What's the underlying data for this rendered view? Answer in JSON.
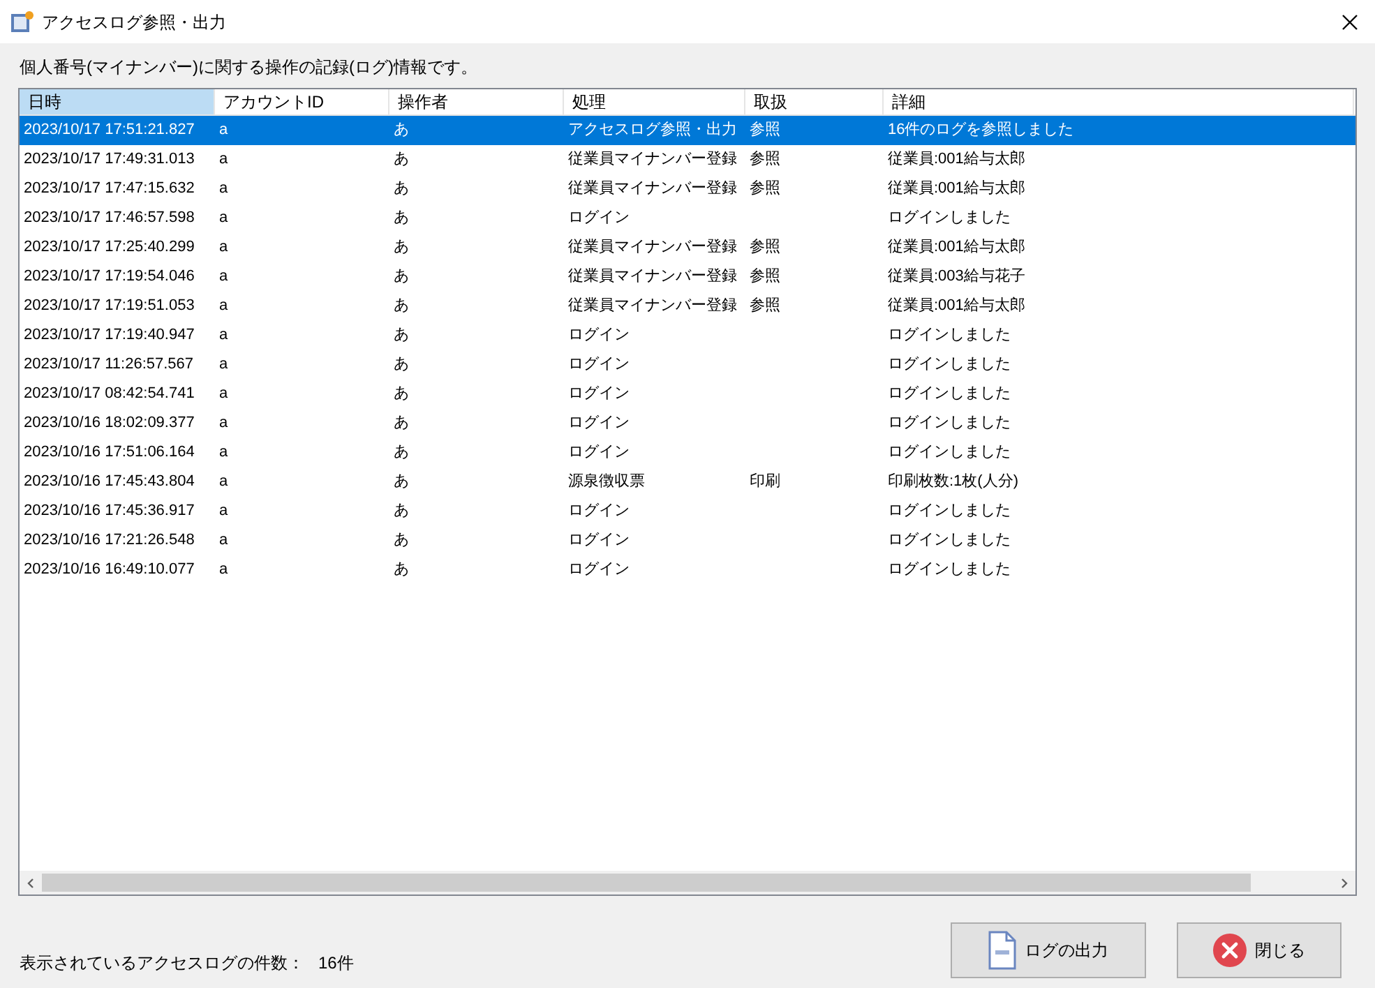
{
  "window": {
    "title": "アクセスログ参照・出力"
  },
  "description": "個人番号(マイナンバー)に関する操作の記録(ログ)情報です。",
  "table": {
    "columns": [
      {
        "label": "日時",
        "selected": true
      },
      {
        "label": "アカウントID",
        "selected": false
      },
      {
        "label": "操作者",
        "selected": false
      },
      {
        "label": "処理",
        "selected": false
      },
      {
        "label": "取扱",
        "selected": false
      },
      {
        "label": "詳細",
        "selected": false
      }
    ],
    "rows": [
      {
        "selected": true,
        "cells": [
          "2023/10/17 17:51:21.827",
          "a",
          "あ",
          "アクセスログ参照・出力",
          "参照",
          "16件のログを参照しました"
        ]
      },
      {
        "selected": false,
        "cells": [
          "2023/10/17 17:49:31.013",
          "a",
          "あ",
          "従業員マイナンバー登録",
          "参照",
          "従業員:001給与太郎"
        ]
      },
      {
        "selected": false,
        "cells": [
          "2023/10/17 17:47:15.632",
          "a",
          "あ",
          "従業員マイナンバー登録",
          "参照",
          "従業員:001給与太郎"
        ]
      },
      {
        "selected": false,
        "cells": [
          "2023/10/17 17:46:57.598",
          "a",
          "あ",
          "ログイン",
          "",
          "ログインしました"
        ]
      },
      {
        "selected": false,
        "cells": [
          "2023/10/17 17:25:40.299",
          "a",
          "あ",
          "従業員マイナンバー登録",
          "参照",
          "従業員:001給与太郎"
        ]
      },
      {
        "selected": false,
        "cells": [
          "2023/10/17 17:19:54.046",
          "a",
          "あ",
          "従業員マイナンバー登録",
          "参照",
          "従業員:003給与花子"
        ]
      },
      {
        "selected": false,
        "cells": [
          "2023/10/17 17:19:51.053",
          "a",
          "あ",
          "従業員マイナンバー登録",
          "参照",
          "従業員:001給与太郎"
        ]
      },
      {
        "selected": false,
        "cells": [
          "2023/10/17 17:19:40.947",
          "a",
          "あ",
          "ログイン",
          "",
          "ログインしました"
        ]
      },
      {
        "selected": false,
        "cells": [
          "2023/10/17 11:26:57.567",
          "a",
          "あ",
          "ログイン",
          "",
          "ログインしました"
        ]
      },
      {
        "selected": false,
        "cells": [
          "2023/10/17 08:42:54.741",
          "a",
          "あ",
          "ログイン",
          "",
          "ログインしました"
        ]
      },
      {
        "selected": false,
        "cells": [
          "2023/10/16 18:02:09.377",
          "a",
          "あ",
          "ログイン",
          "",
          "ログインしました"
        ]
      },
      {
        "selected": false,
        "cells": [
          "2023/10/16 17:51:06.164",
          "a",
          "あ",
          "ログイン",
          "",
          "ログインしました"
        ]
      },
      {
        "selected": false,
        "cells": [
          "2023/10/16 17:45:43.804",
          "a",
          "あ",
          "源泉徴収票",
          "印刷",
          "印刷枚数:1枚(人分)"
        ]
      },
      {
        "selected": false,
        "cells": [
          "2023/10/16 17:45:36.917",
          "a",
          "あ",
          "ログイン",
          "",
          "ログインしました"
        ]
      },
      {
        "selected": false,
        "cells": [
          "2023/10/16 17:21:26.548",
          "a",
          "あ",
          "ログイン",
          "",
          "ログインしました"
        ]
      },
      {
        "selected": false,
        "cells": [
          "2023/10/16 16:49:10.077",
          "a",
          "あ",
          "ログイン",
          "",
          "ログインしました"
        ]
      }
    ]
  },
  "footer": {
    "count_label": "表示されているアクセスログの件数：",
    "count": "16件"
  },
  "buttons": [
    {
      "kind": "export",
      "label": "ログの出力"
    },
    {
      "kind": "close",
      "label": "閉じる"
    }
  ]
}
